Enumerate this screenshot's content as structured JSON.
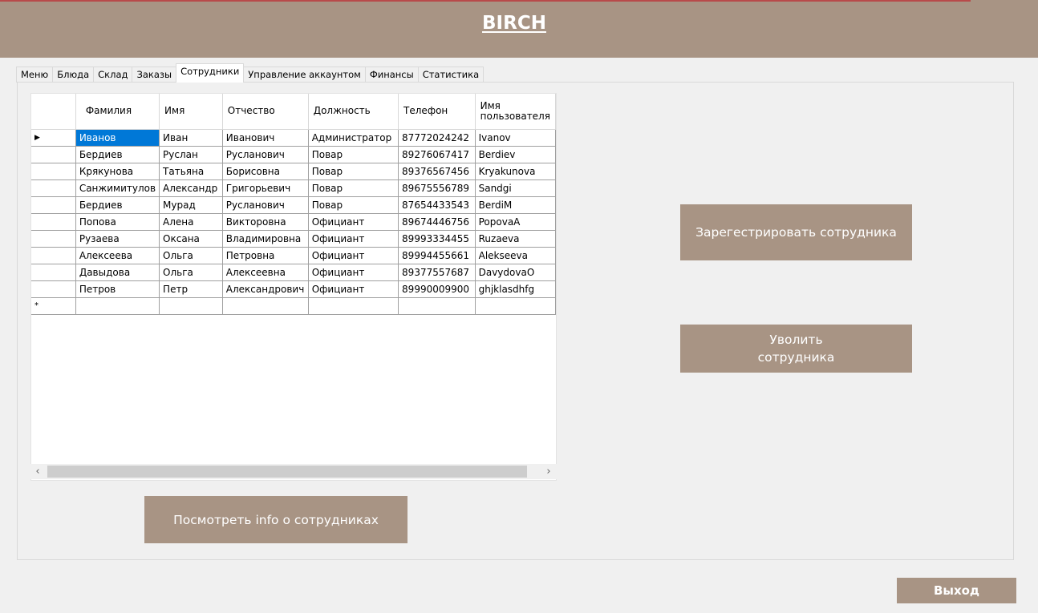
{
  "header": {
    "title": "BIRCH"
  },
  "tabs": [
    {
      "label": "Меню"
    },
    {
      "label": "Блюда"
    },
    {
      "label": "Склад"
    },
    {
      "label": "Заказы"
    },
    {
      "label": "Сотрудники",
      "active": true
    },
    {
      "label": "Управление аккаунтом"
    },
    {
      "label": "Финансы"
    },
    {
      "label": "Статистика"
    }
  ],
  "table": {
    "columns": [
      "Фамилия",
      "Имя",
      "Отчество",
      "Должность",
      "Телефон",
      "Имя пользователя"
    ],
    "current_row_marker": "▶",
    "new_row_marker": "*",
    "rows": [
      [
        "Иванов",
        "Иван",
        "Иванович",
        "Администратор",
        "87772024242",
        "Ivanov"
      ],
      [
        "Бердиев",
        "Руслан",
        "Русланович",
        "Повар",
        "89276067417",
        "Berdiev"
      ],
      [
        "Крякунова",
        "Татьяна",
        "Борисовна",
        "Повар",
        "89376567456",
        "Kryakunova"
      ],
      [
        "Санжимитулов",
        "Александр",
        "Григорьевич",
        "Повар",
        "89675556789",
        "Sandgi"
      ],
      [
        "Бердиев",
        "Мурад",
        "Русланович",
        "Повар",
        "87654433543",
        "BerdiM"
      ],
      [
        "Попова",
        "Алена",
        "Викторовна",
        "Официант",
        "89674446756",
        "PopovaA"
      ],
      [
        "Рузаева",
        "Оксана",
        "Владимировна",
        "Официант",
        "89993334455",
        "Ruzaeva"
      ],
      [
        "Алексеева",
        "Ольга",
        "Петровна",
        "Официант",
        "89994455661",
        "Alekseeva"
      ],
      [
        "Давыдова",
        "Ольга",
        "Алексеевна",
        "Официант",
        "89377557687",
        "DavydovaO"
      ],
      [
        "Петров",
        "Петр",
        "Александрович",
        "Официант",
        "89990009900",
        "ghjklasdhfg"
      ]
    ]
  },
  "scrollbar": {
    "left_arrow": "‹",
    "right_arrow": "›"
  },
  "buttons": {
    "register": "Зарегестрировать сотрудника",
    "fire": "Уволить сотрудника",
    "info": "Посмотреть info о сотрудниках",
    "exit": "Выход"
  }
}
